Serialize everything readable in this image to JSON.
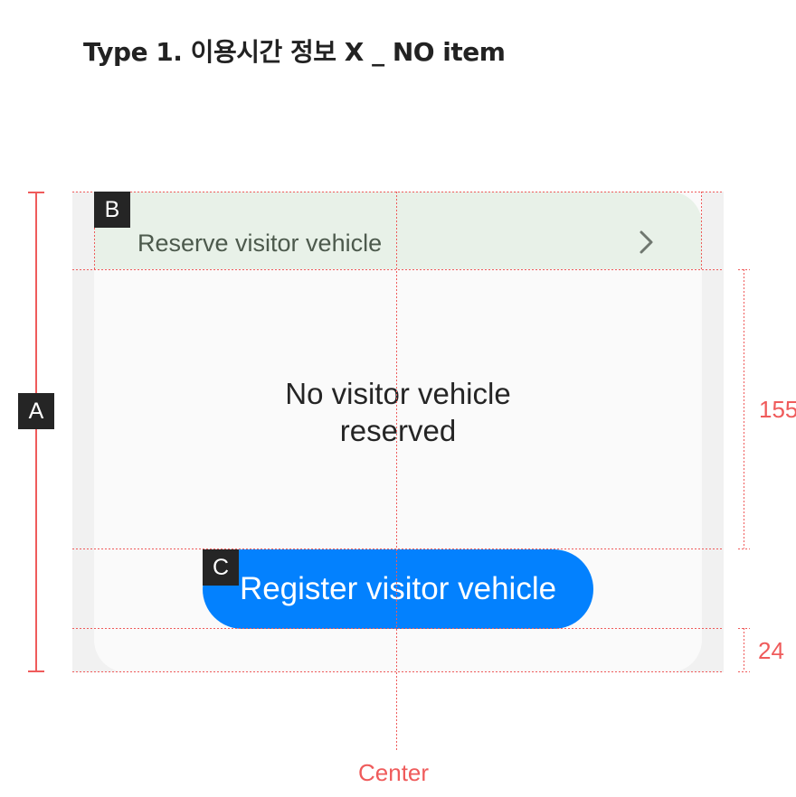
{
  "page": {
    "title": "Type 1. 이용시간 정보 X _ NO item"
  },
  "header": {
    "label": "Reserve visitor vehicle",
    "chevron_icon": "chevron-right-icon"
  },
  "empty_state": {
    "line1": "No visitor vehicle",
    "line2": "reserved"
  },
  "register_button": {
    "label": "Register visitor vehicle"
  },
  "annotations": {
    "tag_a": "A",
    "tag_b": "B",
    "tag_c": "C",
    "spacing_content": "155",
    "spacing_bottom": "24",
    "center_label": "Center"
  },
  "colors": {
    "page_bg": "#ffffff",
    "outer_bg": "#f1f1f1",
    "card_bg": "#fafafa",
    "header_bg": "#e8f1e8",
    "button_bg": "#0381fe",
    "guide_red": "#ef5b5b",
    "tag_bg": "#252525"
  }
}
